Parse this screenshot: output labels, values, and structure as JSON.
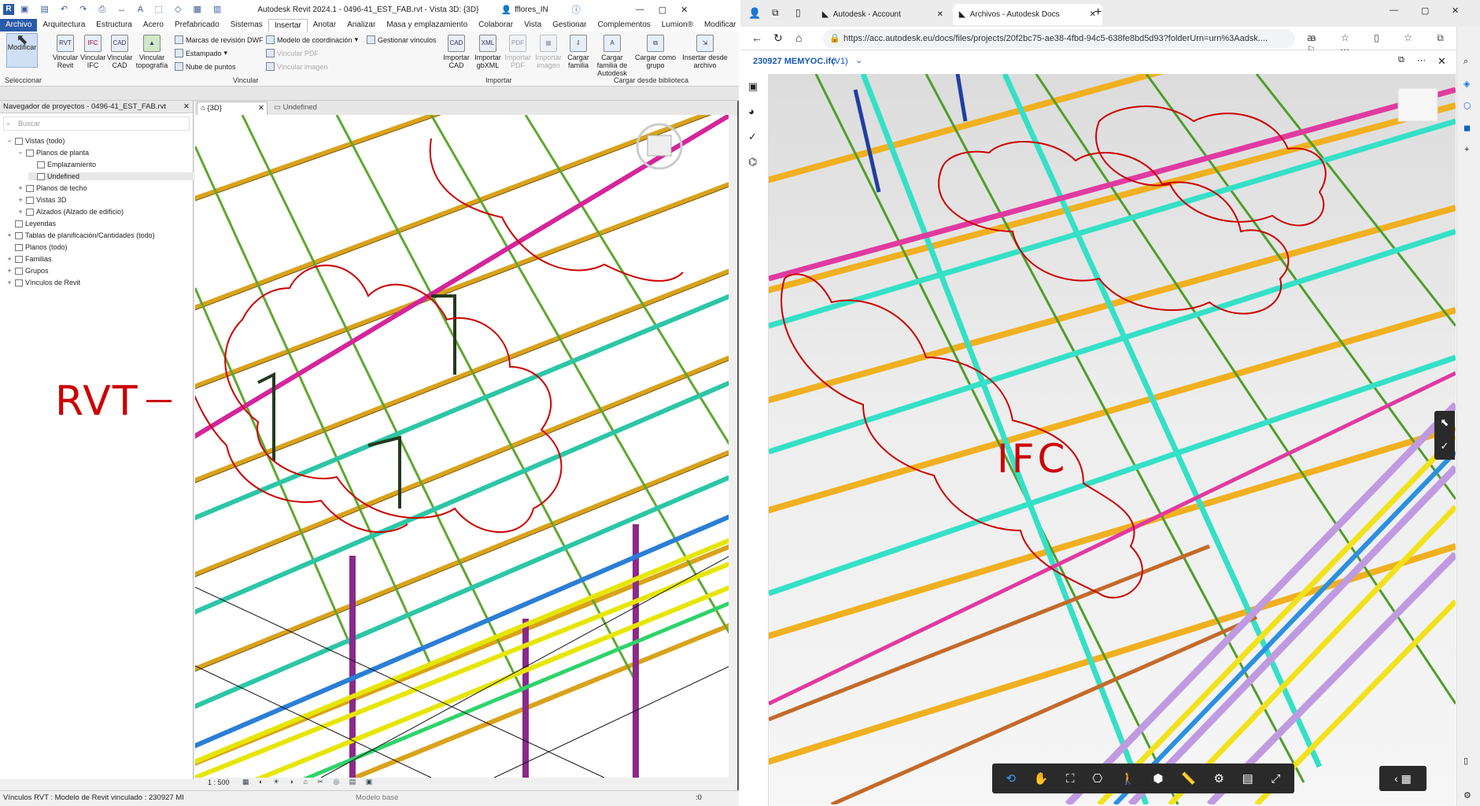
{
  "revit": {
    "qat_icons": [
      "revit-logo-icon",
      "open-icon",
      "save-icon",
      "undo-icon",
      "redo-icon",
      "print-icon",
      "measure-icon",
      "text-icon",
      "3d-view-icon",
      "section-icon",
      "close-hidden-icon",
      "switch-windows-icon"
    ],
    "title": "Autodesk Revit 2024.1 - 0496-41_EST_FAB.rvt - Vista 3D: {3D}",
    "user": "fflores_IN",
    "tabs": [
      "Archivo",
      "Arquitectura",
      "Estructura",
      "Acero",
      "Prefabricado",
      "Sistemas",
      "Insertar",
      "Anotar",
      "Analizar",
      "Masa y emplazamiento",
      "Colaborar",
      "Vista",
      "Gestionar",
      "Complementos",
      "Lumion®",
      "Modificar"
    ],
    "active_tab": "Insertar",
    "ribbon": {
      "modificar": "Modificar",
      "seleccionar": "Seleccionar",
      "vincular_revit": "Vincular Revit",
      "vincular_ifc": "Vincular IFC",
      "vincular_cad": "Vincular CAD",
      "vincular_topografia": "Vincular topografía",
      "marcas_dwf": "Marcas de revisión DWF",
      "estampado": "Estampado",
      "nube_puntos": "Nube de puntos",
      "modelo_coordinacion": "Modelo de coordinación",
      "gestionar_vinculos": "Gestionar vínculos",
      "vincular_pdf": "Vincular PDF",
      "vincular_imagen": "Vincular imagen",
      "grp_vincular": "Vincular",
      "importar_cad": "Importar CAD",
      "importar_gbxml": "Importar gbXML",
      "importar_pdf": "Importar PDF",
      "importar_imagen": "Importar imagen",
      "grp_importar": "Importar",
      "cargar_familia": "Cargar familia",
      "cargar_familia_autodesk": "Cargar familia de Autodesk",
      "cargar_como_grupo": "Cargar como grupo",
      "insertar_desde_archivo": "Insertar desde archivo",
      "grp_cargar": "Cargar desde biblioteca"
    },
    "navigator": {
      "title": "Navegador de proyectos - 0496-41_EST_FAB.rvt",
      "search_placeholder": "Buscar",
      "items": [
        {
          "label": "Vistas (todo)",
          "level": 0,
          "toggle": "−"
        },
        {
          "label": "Planos de planta",
          "level": 1,
          "toggle": "−"
        },
        {
          "label": "Emplazamiento",
          "level": 2,
          "toggle": ""
        },
        {
          "label": "Undefined",
          "level": 2,
          "toggle": ""
        },
        {
          "label": "Planos de techo",
          "level": 1,
          "toggle": "+"
        },
        {
          "label": "Vistas 3D",
          "level": 1,
          "toggle": "+"
        },
        {
          "label": "Alzados (Alzado de edificio)",
          "level": 1,
          "toggle": "+"
        },
        {
          "label": "Leyendas",
          "level": 0,
          "toggle": ""
        },
        {
          "label": "Tablas de planificación/Cantidades (todo)",
          "level": 0,
          "toggle": "+"
        },
        {
          "label": "Planos (todo)",
          "level": 0,
          "toggle": ""
        },
        {
          "label": "Familias",
          "level": 0,
          "toggle": "+"
        },
        {
          "label": "Grupos",
          "level": 0,
          "toggle": "+"
        },
        {
          "label": "Vínculos de Revit",
          "level": 0,
          "toggle": "+"
        }
      ]
    },
    "view_tabs": [
      "{3D}",
      "Undefined"
    ],
    "scale": "1 : 500",
    "status_text": "Vínculos RVT : Modelo de Revit vinculado : 230927 MI",
    "model_base": "Modelo base",
    "filter_count": ":0",
    "annotation": "RVT"
  },
  "edge": {
    "tabs": [
      {
        "label": "Autodesk - Account",
        "active": false
      },
      {
        "label": "Archivos - Autodesk Docs",
        "active": true
      }
    ],
    "url": "https://acc.autodesk.eu/docs/files/projects/20f2bc75-ae38-4fbd-94c5-638fe8bd5d93?folderUrn=urn%3Aadsk....",
    "file_name": "230927 MEMYOC.ifc",
    "version": "(V1)",
    "annotation": "IFC"
  }
}
